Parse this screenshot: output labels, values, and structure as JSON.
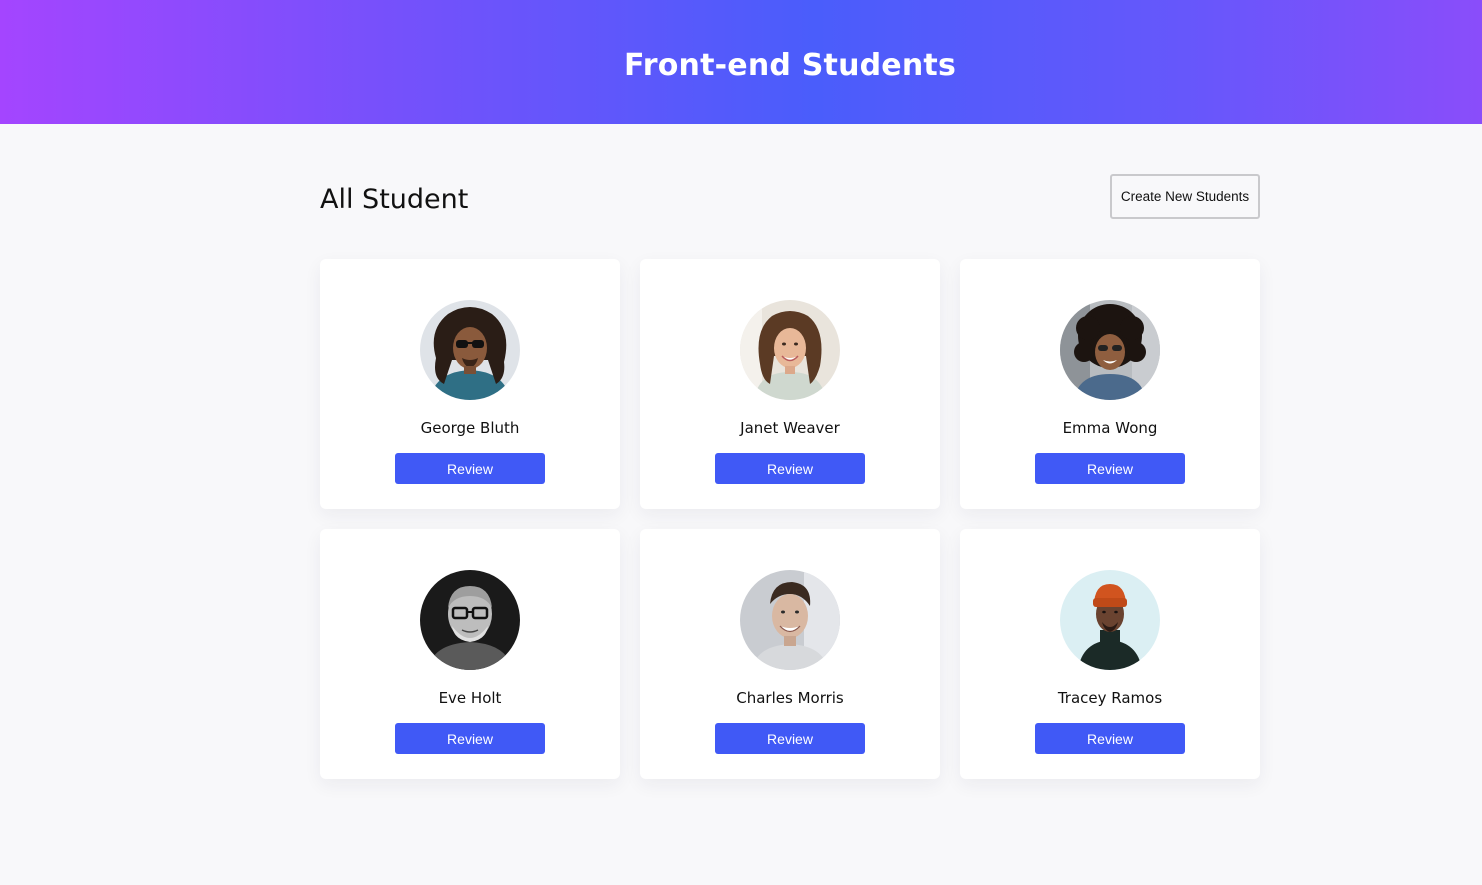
{
  "header": {
    "title": "Front-end Students"
  },
  "section": {
    "title": "All Student",
    "create_button_label": "Create New Students"
  },
  "theme": {
    "header_gradient_start": "#a445ff",
    "header_gradient_mid": "#4a5dfb",
    "button_color": "#4059f6",
    "page_background": "#f8f8fa"
  },
  "students": [
    {
      "name": "George Bluth",
      "review_label": "Review",
      "avatar": "avatar-photo-george"
    },
    {
      "name": "Janet Weaver",
      "review_label": "Review",
      "avatar": "avatar-photo-janet"
    },
    {
      "name": "Emma Wong",
      "review_label": "Review",
      "avatar": "avatar-photo-emma"
    },
    {
      "name": "Eve Holt",
      "review_label": "Review",
      "avatar": "avatar-photo-eve"
    },
    {
      "name": "Charles Morris",
      "review_label": "Review",
      "avatar": "avatar-photo-charles"
    },
    {
      "name": "Tracey Ramos",
      "review_label": "Review",
      "avatar": "avatar-photo-tracey"
    }
  ]
}
